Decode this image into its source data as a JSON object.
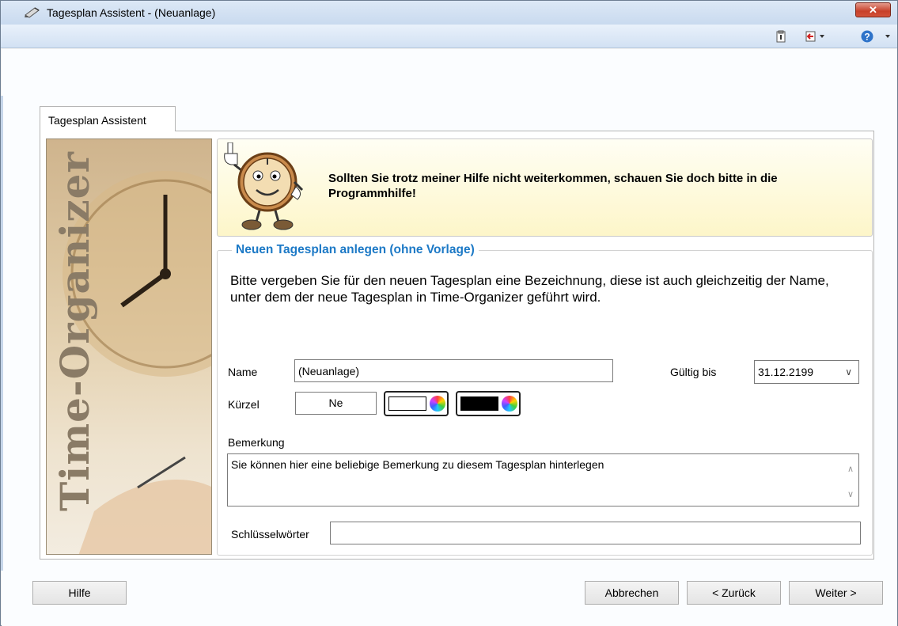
{
  "window": {
    "title": "Tagesplan Assistent - (Neuanlage)",
    "close_glyph": "✕"
  },
  "toolbar": {
    "icons": [
      "clipboard-icon",
      "exit-icon",
      "help-icon"
    ]
  },
  "tab": {
    "label": "Tagesplan Assistent"
  },
  "side_image": {
    "text": "Time-Organizer"
  },
  "hint": {
    "text": "Sollten Sie trotz meiner Hilfe nicht weiterkommen, schauen Sie doch bitte in die Programmhilfe!"
  },
  "group": {
    "title": "Neuen Tagesplan anlegen (ohne Vorlage)",
    "description": "Bitte vergeben Sie für den neuen Tagesplan eine Bezeichnung, diese ist auch gleichzeitig der Name, unter dem der neue Tagesplan in Time-Organizer geführt wird."
  },
  "form": {
    "name_label": "Name",
    "name_value": "(Neuanlage)",
    "valid_until_label": "Gültig bis",
    "valid_until_value": "31.12.2199",
    "short_label": "Kürzel",
    "short_value": "Ne",
    "text_color": "#ffffff",
    "back_color": "#000000",
    "remark_label": "Bemerkung",
    "remark_value": "Sie können hier eine beliebige Bemerkung zu diesem Tagesplan hinterlegen",
    "keywords_label": "Schlüsselwörter",
    "keywords_value": ""
  },
  "buttons": {
    "help": "Hilfe",
    "cancel": "Abbrechen",
    "back": "< Zurück",
    "next": "Weiter >"
  }
}
